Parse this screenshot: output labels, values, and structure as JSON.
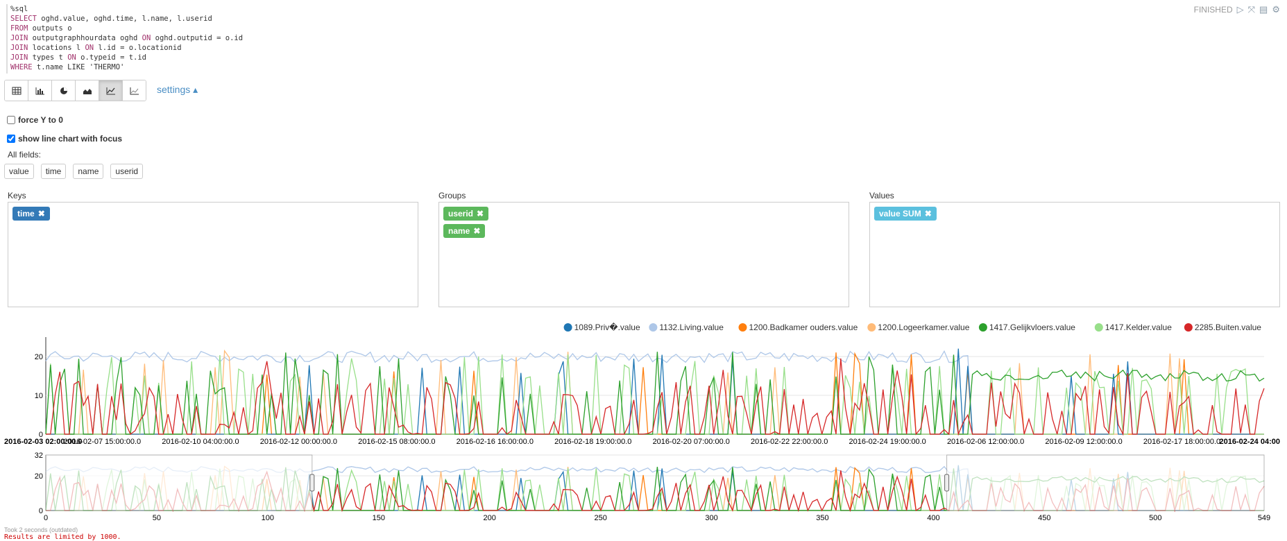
{
  "code": {
    "lines": [
      [
        {
          "t": "%sql",
          "k": false
        }
      ],
      [
        {
          "t": "SELECT",
          "k": true
        },
        {
          "t": " oghd.value, oghd.time, l.name, l.userid",
          "k": false
        }
      ],
      [
        {
          "t": "FROM",
          "k": true
        },
        {
          "t": " outputs o",
          "k": false
        }
      ],
      [
        {
          "t": "JOIN",
          "k": true
        },
        {
          "t": " outputgraphhourdata oghd ",
          "k": false
        },
        {
          "t": "ON",
          "k": true
        },
        {
          "t": " oghd.outputid = o.id",
          "k": false
        }
      ],
      [
        {
          "t": "JOIN",
          "k": true
        },
        {
          "t": " locations l ",
          "k": false
        },
        {
          "t": "ON",
          "k": true
        },
        {
          "t": " l.id = o.locationid",
          "k": false
        }
      ],
      [
        {
          "t": "JOIN",
          "k": true
        },
        {
          "t": " types t ",
          "k": false
        },
        {
          "t": "ON",
          "k": true
        },
        {
          "t": " o.typeid = t.id",
          "k": false
        }
      ],
      [
        {
          "t": "WHERE",
          "k": true
        },
        {
          "t": " t.name LIKE 'THERMO'",
          "k": false
        }
      ]
    ]
  },
  "status": {
    "label": "FINISHED",
    "icons": [
      "play-icon",
      "expand-icon",
      "book-icon",
      "gear-icon"
    ]
  },
  "toolbar": {
    "buttons": [
      "table-icon",
      "bar-chart-icon",
      "pie-chart-icon",
      "area-chart-icon",
      "line-chart-icon",
      "scatter-chart-icon"
    ],
    "active": 4
  },
  "settings": {
    "label": "settings ▴"
  },
  "options": {
    "force_y0": "force Y to 0",
    "focus": "show line chart with focus"
  },
  "fields": {
    "label": "All fields:",
    "items": [
      "value",
      "time",
      "name",
      "userid"
    ]
  },
  "zones": {
    "keys": {
      "label": "Keys",
      "chips": [
        "time"
      ]
    },
    "groups": {
      "label": "Groups",
      "chips": [
        "userid",
        "name"
      ]
    },
    "values": {
      "label": "Values",
      "chips": [
        "value  SUM"
      ]
    }
  },
  "chart_data": {
    "type": "line",
    "series": [
      {
        "name": "1089.Priv�.value",
        "color": "#1f77b4"
      },
      {
        "name": "1132.Living.value",
        "color": "#aec7e8"
      },
      {
        "name": "1200.Badkamer ouders.value",
        "color": "#ff7f0e"
      },
      {
        "name": "1200.Logeerkamer.value",
        "color": "#ffbb78"
      },
      {
        "name": "1417.Gelijkvloers.value",
        "color": "#2ca02c"
      },
      {
        "name": "1417.Kelder.value",
        "color": "#98df8a"
      },
      {
        "name": "2285.Buiten.value",
        "color": "#d62728"
      }
    ],
    "main_yticks": [
      "0",
      "10",
      "20"
    ],
    "main_xticks": [
      "2016-02-03 02:00:00.0",
      "2016-02-07 15:00:00.0",
      "2016-02-10 04:00:00.0",
      "2016-02-12 00:00:00.0",
      "2016-02-15 08:00:00.0",
      "2016-02-16 16:00:00.0",
      "2016-02-18 19:00:00.0",
      "2016-02-20 07:00:00.0",
      "2016-02-22 22:00:00.0",
      "2016-02-24 19:00:00.0",
      "2016-02-06 12:00:00.0",
      "2016-02-09 12:00:00.0",
      "2016-02-17 18:00:00.0",
      "2016-02-24 04:00"
    ],
    "focus_yticks": [
      "0",
      "20",
      "32"
    ],
    "focus_xticks": [
      "0",
      "50",
      "100",
      "150",
      "200",
      "250",
      "300",
      "350",
      "400",
      "450",
      "500",
      "549"
    ],
    "ylim": [
      0,
      25
    ],
    "brush": [
      120,
      406
    ]
  },
  "footer": {
    "took": "Took 2 seconds (outdated)",
    "limit": "Results are limited by 1000."
  }
}
